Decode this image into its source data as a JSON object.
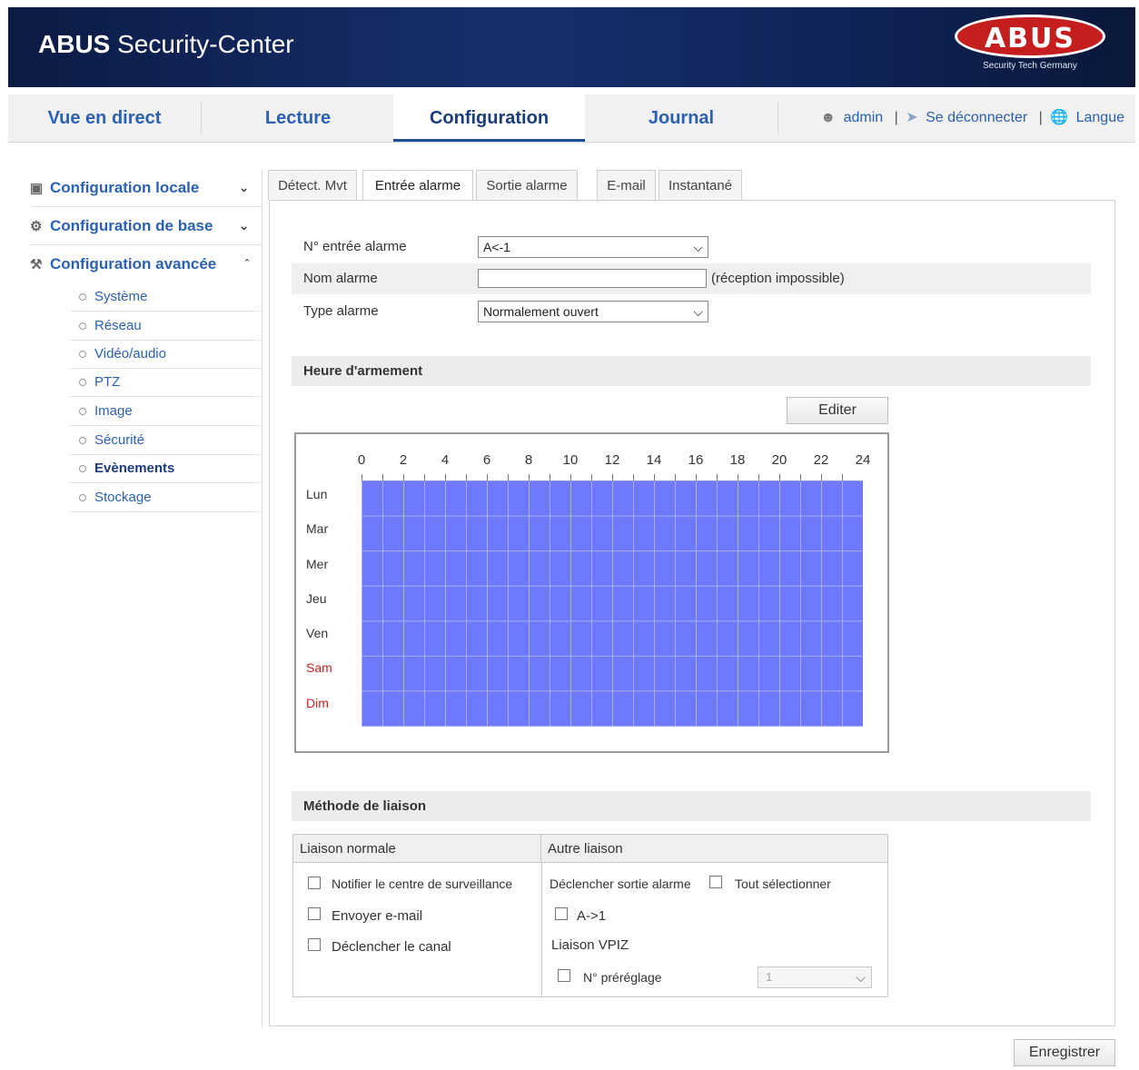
{
  "header": {
    "title_bold": "ABUS",
    "title_rest": " Security-Center",
    "logo_text": "ABUS",
    "logo_tagline": "Security Tech Germany"
  },
  "nav": {
    "tabs": [
      "Vue en direct",
      "Lecture",
      "Configuration",
      "Journal"
    ],
    "active_tab": "Configuration",
    "user": "admin",
    "sep": "|",
    "logout": "Se déconnecter",
    "language": "Langue"
  },
  "sidebar": {
    "groups": [
      {
        "label": "Configuration locale",
        "state": "collapsed"
      },
      {
        "label": "Configuration de base",
        "state": "collapsed"
      },
      {
        "label": "Configuration avancée",
        "state": "expanded"
      }
    ],
    "items": [
      "Système",
      "Réseau",
      "Vidéo/audio",
      "PTZ",
      "Image",
      "Sécurité",
      "Evènements",
      "Stockage"
    ],
    "active_item": "Evènements"
  },
  "subtabs": [
    "Détect. Mvt",
    "Entrée alarme",
    "Sortie alarme",
    "E-mail",
    "Instantané"
  ],
  "form": {
    "input_no_label": "N° entrée alarme",
    "input_no_value": "A<-1",
    "name_label": "Nom alarme",
    "name_value": "",
    "name_hint": "(réception impossible)",
    "type_label": "Type alarme",
    "type_value": "Normalement ouvert"
  },
  "schedule": {
    "section_title": "Heure d'armement",
    "edit_button": "Editer",
    "hours": [
      "0",
      "2",
      "4",
      "6",
      "8",
      "10",
      "12",
      "14",
      "16",
      "18",
      "20",
      "22",
      "24"
    ],
    "days": [
      "Lun",
      "Mar",
      "Mer",
      "Jeu",
      "Ven",
      "Sam",
      "Dim"
    ],
    "armed_color": "#6e79ff",
    "weekend_color": "#cc2222"
  },
  "linkage": {
    "section_title": "Méthode de liaison",
    "normal_header": "Liaison normale",
    "other_header": "Autre liaison",
    "notify": "Notifier le centre de surveillance",
    "email": "Envoyer e-mail",
    "channel": "Déclencher le canal",
    "trigger_out": "Déclencher sortie alarme",
    "select_all": "Tout sélectionner",
    "out_a1": "A->1",
    "ptz_link": "Liaison VPIZ",
    "preset_label": "N° préréglage",
    "preset_value": "1"
  },
  "save_button": "Enregistrer"
}
